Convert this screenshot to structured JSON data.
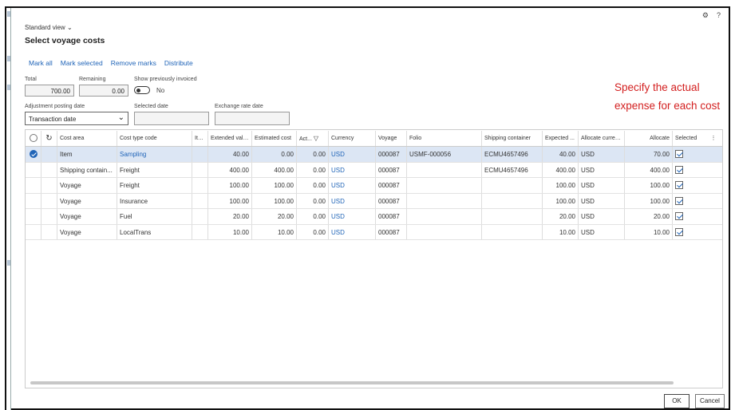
{
  "header": {
    "view_label": "Standard view",
    "title": "Select voyage costs"
  },
  "actions": [
    "Mark all",
    "Mark selected",
    "Remove marks",
    "Distribute"
  ],
  "fields": {
    "total_label": "Total",
    "total_value": "700.00",
    "remaining_label": "Remaining",
    "remaining_value": "0.00",
    "show_invoiced_label": "Show previously invoiced",
    "show_invoiced_value": "No",
    "adj_posting_date_label": "Adjustment posting date",
    "adj_posting_date_value": "Transaction date",
    "selected_date_label": "Selected date",
    "exchange_rate_date_label": "Exchange rate date"
  },
  "annotation": "Specify the actual expense for each cost",
  "grid": {
    "columns": [
      "Cost area",
      "Cost type code",
      "Ite...",
      "Extended value",
      "Estimated cost",
      "Act...",
      "Currency",
      "Voyage",
      "Folio",
      "Shipping container",
      "Expected ...",
      "Allocate curren...",
      "Allocate",
      "Selected"
    ],
    "rows": [
      [
        "Item",
        "Sampling",
        "",
        "40.00",
        "0.00",
        "0.00",
        "USD",
        "000087",
        "USMF-000056",
        "ECMU4657496",
        "40.00",
        "USD",
        "70.00"
      ],
      [
        "Shipping contain...",
        "Freight",
        "",
        "400.00",
        "400.00",
        "0.00",
        "USD",
        "000087",
        "",
        "ECMU4657496",
        "400.00",
        "USD",
        "400.00"
      ],
      [
        "Voyage",
        "Freight",
        "",
        "100.00",
        "100.00",
        "0.00",
        "USD",
        "000087",
        "",
        "",
        "100.00",
        "USD",
        "100.00"
      ],
      [
        "Voyage",
        "Insurance",
        "",
        "100.00",
        "100.00",
        "0.00",
        "USD",
        "000087",
        "",
        "",
        "100.00",
        "USD",
        "100.00"
      ],
      [
        "Voyage",
        "Fuel",
        "",
        "20.00",
        "20.00",
        "0.00",
        "USD",
        "000087",
        "",
        "",
        "20.00",
        "USD",
        "20.00"
      ],
      [
        "Voyage",
        "LocalTrans",
        "",
        "10.00",
        "10.00",
        "0.00",
        "USD",
        "000087",
        "",
        "",
        "10.00",
        "USD",
        "10.00"
      ]
    ]
  },
  "footer": {
    "ok": "OK",
    "cancel": "Cancel"
  },
  "colors": {
    "accent": "#2165b8",
    "annotation": "#d31f1f",
    "selected_row": "#dce6f4"
  }
}
